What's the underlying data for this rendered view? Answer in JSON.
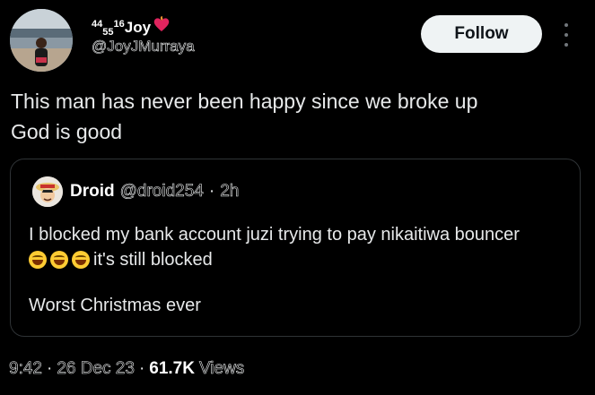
{
  "author": {
    "display_name_parts": [
      "44",
      "55",
      "16",
      "Joy"
    ],
    "handle": "@JoyJMurraya"
  },
  "follow_label": "Follow",
  "tweet_text": "This man has never been happy since we broke up\nGod is good",
  "quote": {
    "name": "Droid",
    "handle": "@droid254",
    "separator": "·",
    "time": "2h",
    "line1": "I blocked my bank account juzi trying to pay nikaitiwa bouncer",
    "line2": "it's still blocked",
    "line3": "Worst Christmas ever"
  },
  "meta": {
    "time": "9:42",
    "date": "26 Dec 23",
    "views_count": "61.7K",
    "views_label": "Views",
    "separator": "·"
  },
  "colors": {
    "background": "#000000",
    "text": "#e7e9ea",
    "follow_bg": "#eff3f4",
    "border": "#2f3336"
  }
}
